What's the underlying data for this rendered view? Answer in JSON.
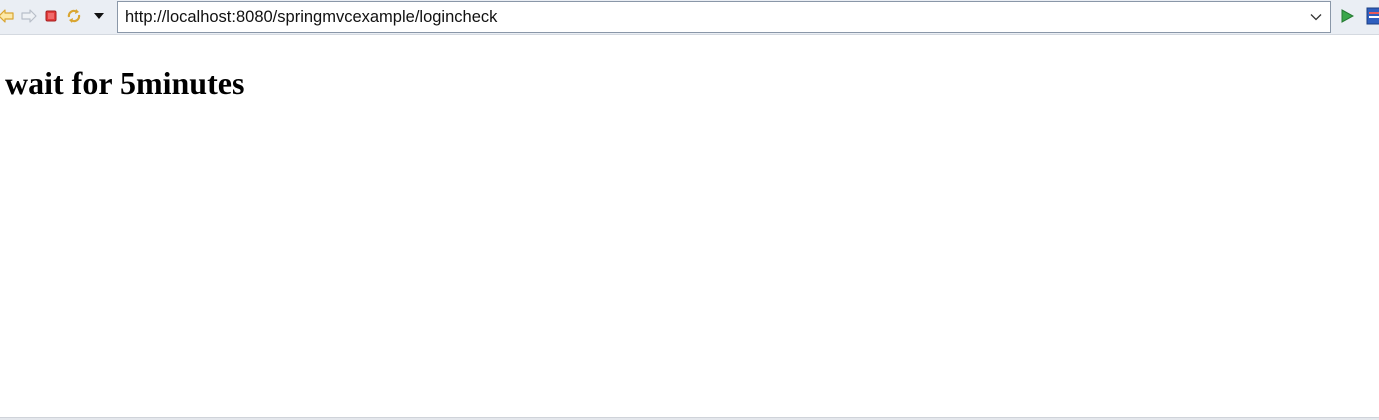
{
  "toolbar": {
    "back_icon": "arrow-left-icon",
    "forward_icon": "arrow-right-icon",
    "stop_icon": "stop-icon",
    "refresh_icon": "refresh-icon",
    "menu_icon": "triangle-down-icon",
    "go_icon": "play-icon",
    "colors": {
      "back": "#f0b429",
      "stop": "#e23b3b",
      "go": "#3aa64a"
    }
  },
  "address_bar": {
    "url": "http://localhost:8080/springmvcexample/logincheck"
  },
  "page": {
    "heading": "wait for 5minutes"
  }
}
